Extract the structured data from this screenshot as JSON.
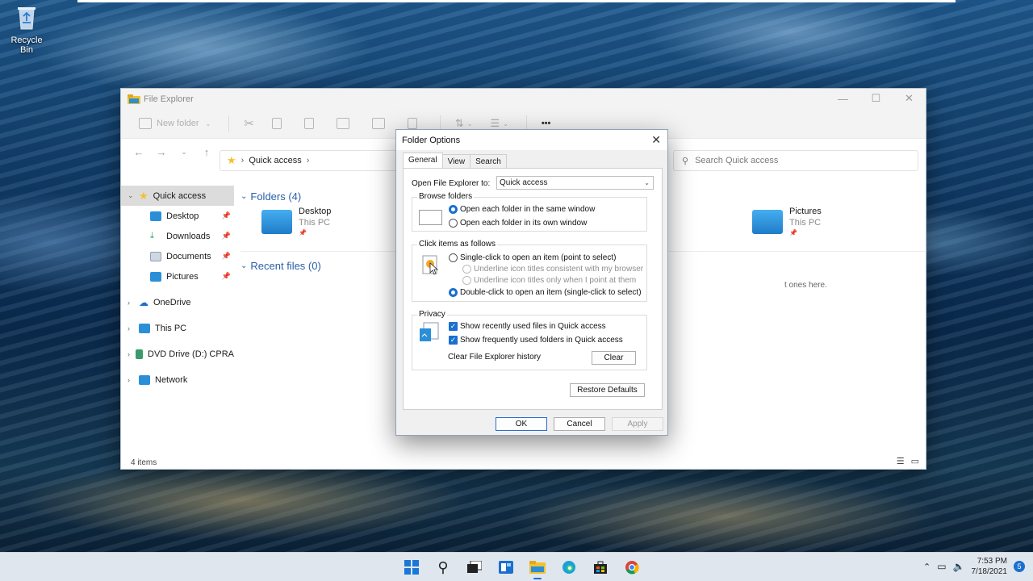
{
  "desktop": {
    "recycle_bin_label": "Recycle Bin"
  },
  "explorer": {
    "title": "File Explorer",
    "window_controls": {
      "minimize": "—",
      "maximize": "☐",
      "close": "✕"
    },
    "toolbar": {
      "new_folder": "New folder",
      "more": "•••"
    },
    "address": {
      "location": "Quick access"
    },
    "search_placeholder": "Search Quick access",
    "nav": {
      "quick_access": "Quick access",
      "pinned": [
        "Desktop",
        "Downloads",
        "Documents",
        "Pictures"
      ],
      "onedrive": "OneDrive",
      "this_pc": "This PC",
      "dvd": "DVD Drive (D:) CPRA",
      "network": "Network"
    },
    "folders_header": "Folders (4)",
    "recent_header": "Recent files (0)",
    "folders": [
      {
        "name": "Desktop",
        "sub": "This PC"
      },
      {
        "name": "Pictures",
        "sub": "This PC"
      }
    ],
    "recent_hint": "t ones here.",
    "status": "4 items"
  },
  "dialog": {
    "title": "Folder Options",
    "close": "✕",
    "tabs": [
      "General",
      "View",
      "Search"
    ],
    "open_to_label": "Open File Explorer to:",
    "open_to_value": "Quick access",
    "browse": {
      "legend": "Browse folders",
      "same_window": "Open each folder in the same window",
      "own_window": "Open each folder in its own window"
    },
    "click": {
      "legend": "Click items as follows",
      "single": "Single-click to open an item (point to select)",
      "underline_browser": "Underline icon titles consistent with my browser",
      "underline_point": "Underline icon titles only when I point at them",
      "double": "Double-click to open an item (single-click to select)"
    },
    "privacy": {
      "legend": "Privacy",
      "recent_files": "Show recently used files in Quick access",
      "frequent_folders": "Show frequently used folders in Quick access",
      "clear_label": "Clear File Explorer history",
      "clear_button": "Clear"
    },
    "restore_defaults": "Restore Defaults",
    "ok": "OK",
    "cancel": "Cancel",
    "apply": "Apply"
  },
  "taskbar": {
    "time": "7:53 PM",
    "date": "7/18/2021",
    "notifications": "5"
  },
  "colors": {
    "accent": "#1a6fcf",
    "folder_blue": "#2b8fd8",
    "star_yellow": "#f2c12e"
  }
}
